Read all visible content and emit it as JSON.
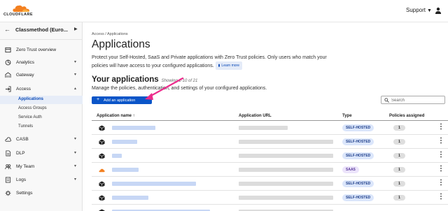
{
  "header": {
    "brand": "CLOUDFLARE",
    "support_label": "Support",
    "brand_color": "#f38020"
  },
  "sidebar": {
    "account_name": "Classmethod (Euro...",
    "items": [
      {
        "label": "Zero Trust overview",
        "icon": "overview-icon",
        "chevron": ""
      },
      {
        "label": "Analytics",
        "icon": "analytics-icon",
        "chevron": "▾"
      },
      {
        "label": "Gateway",
        "icon": "gateway-icon",
        "chevron": "▾"
      },
      {
        "label": "Access",
        "icon": "access-icon",
        "chevron": "▴"
      },
      {
        "label": "CASB",
        "icon": "casb-icon",
        "chevron": "▾"
      },
      {
        "label": "DLP",
        "icon": "dlp-icon",
        "chevron": "▾"
      },
      {
        "label": "My Team",
        "icon": "team-icon",
        "chevron": "▾"
      },
      {
        "label": "Logs",
        "icon": "logs-icon",
        "chevron": "▾"
      },
      {
        "label": "Settings",
        "icon": "gear-icon",
        "chevron": ""
      }
    ],
    "access_subitems": [
      "Applications",
      "Access Groups",
      "Service Auth",
      "Tunnels"
    ]
  },
  "main": {
    "breadcrumb": "Access  /  Applications",
    "title": "Applications",
    "description": "Protect your Self-Hosted, SaaS and Private applications with Zero Trust policies. Only users who match your policies will have access to your configured applications.",
    "learn_more": "Learn more",
    "section_title": "Your applications",
    "showing": "Showing 1-10 of 21",
    "section_subtitle": "Manage the policies, authentication, and settings of your configured applications.",
    "add_button": "Add an application",
    "search_placeholder": "Search"
  },
  "table": {
    "columns": [
      "Application name ↑",
      "Application URL",
      "Type",
      "Policies assigned"
    ],
    "rows": [
      {
        "type": "SELF-HOSTED",
        "policies": "1"
      },
      {
        "type": "SELF-HOSTED",
        "policies": "1"
      },
      {
        "type": "SELF-HOSTED",
        "policies": "1"
      },
      {
        "type": "SAAS",
        "policies": "1"
      },
      {
        "type": "SELF-HOSTED",
        "policies": "1"
      },
      {
        "type": "SELF-HOSTED",
        "policies": "1"
      }
    ]
  }
}
